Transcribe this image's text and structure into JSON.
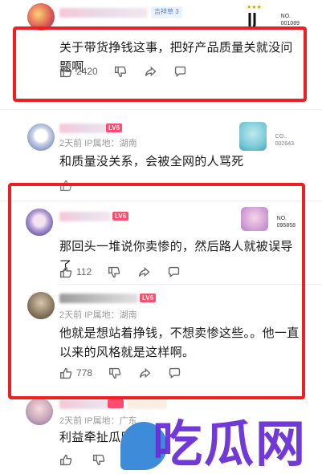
{
  "comments": [
    {
      "name": "",
      "level": "",
      "badge": "吉祥草 3",
      "meta": "",
      "text": "关于带货挣钱这事，把好产品质量关就没问题啊",
      "likes": "2420",
      "fan_card_no": "NO.\n001089"
    },
    {
      "name": "",
      "level": "LV6",
      "meta": "2天前  IP属地：湖南",
      "text": "和质量没关系，会被全网的人骂死",
      "likes": "",
      "fan_card_no": "CO..\n002643"
    },
    {
      "name": "",
      "level": "LV6",
      "meta": "",
      "text": "那回头一堆说你卖惨的，然后路人就被误导了",
      "likes": "112",
      "fan_card_no": "NO.\n095858"
    },
    {
      "name": "",
      "level": "LV6",
      "meta": "2天前  IP属地：湖南",
      "text": "他就是想站着挣钱，不想卖惨这些。。他一直以来的风格就是这样啊。",
      "likes": "778"
    },
    {
      "name": "",
      "level": "",
      "badge": "",
      "meta": "2天前  IP属地：广东",
      "text": "利益牵扯瓜田李下",
      "likes": ""
    }
  ],
  "watermark": {
    "text": "吃瓜网"
  },
  "colors": {
    "highlight": "#f01e1e",
    "level_badge": "#ff4d6d",
    "watermark": "#6a2fd6"
  }
}
